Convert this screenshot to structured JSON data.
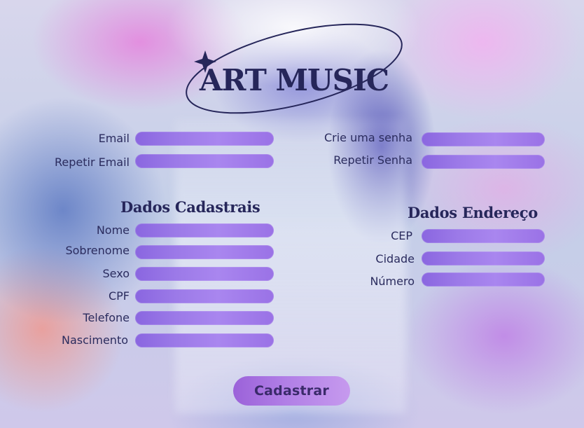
{
  "logo": {
    "text": "ART MUSIC"
  },
  "login": {
    "email_label": "Email",
    "repeat_email_label": "Repetir Email",
    "password_label": "Crie uma senha",
    "repeat_password_label": "Repetir Senha"
  },
  "cadastrais": {
    "title": "Dados Cadastrais",
    "fields": [
      "Nome",
      "Sobrenome",
      "Sexo",
      "CPF",
      "Telefone",
      "Nascimento"
    ]
  },
  "endereco": {
    "title": "Dados Endereço",
    "fields": [
      "CEP",
      "Cidade",
      "Número"
    ]
  },
  "submit_label": "Cadastrar",
  "colors": {
    "accent": "#9c7ae8",
    "text": "#26265a"
  }
}
